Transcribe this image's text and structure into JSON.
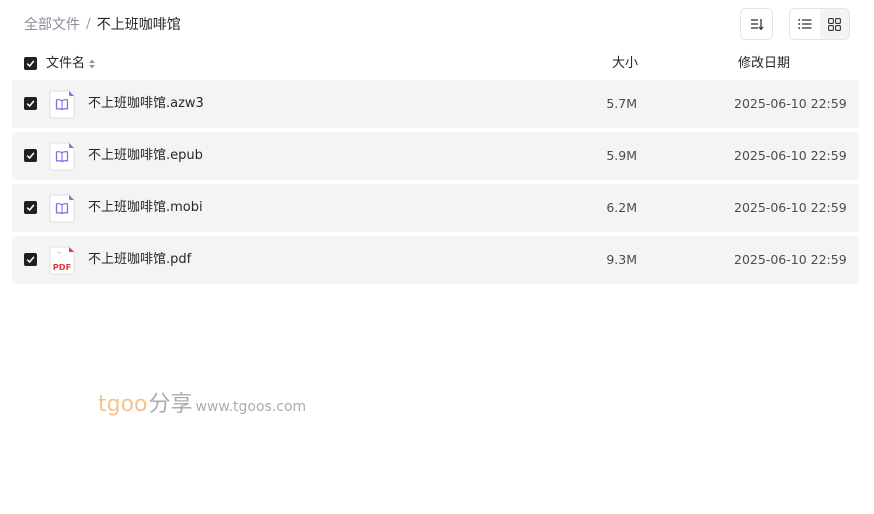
{
  "breadcrumb": {
    "root": "全部文件",
    "separator": "/",
    "current": "不上班咖啡馆"
  },
  "toolbar": {
    "sort_icon": "sort-icon",
    "list_view_icon": "list-view-icon",
    "grid_view_icon": "grid-view-icon",
    "active_view": "list"
  },
  "table": {
    "columns": {
      "name": "文件名",
      "size": "大小",
      "date": "修改日期"
    },
    "rows": [
      {
        "name": "不上班咖啡馆.azw3",
        "size": "5.7M",
        "date": "2025-06-10 22:59",
        "icon": "ebook-icon",
        "checked": true
      },
      {
        "name": "不上班咖啡馆.epub",
        "size": "5.9M",
        "date": "2025-06-10 22:59",
        "icon": "ebook-icon",
        "checked": true
      },
      {
        "name": "不上班咖啡馆.mobi",
        "size": "6.2M",
        "date": "2025-06-10 22:59",
        "icon": "ebook-icon",
        "checked": true
      },
      {
        "name": "不上班咖啡馆.pdf",
        "size": "9.3M",
        "date": "2025-06-10 22:59",
        "icon": "pdf-icon",
        "pdf_label": "PDF",
        "checked": true
      }
    ]
  },
  "watermark": {
    "brand": "tgoo",
    "share": "分享",
    "url": "www.tgoos.com"
  },
  "colors": {
    "row_bg": "#f4f4f5",
    "checkbox": "#1f2023",
    "ebook_accent": "#8b6fe0",
    "pdf_accent": "#e5383b",
    "watermark_brand": "#f5c48a"
  }
}
